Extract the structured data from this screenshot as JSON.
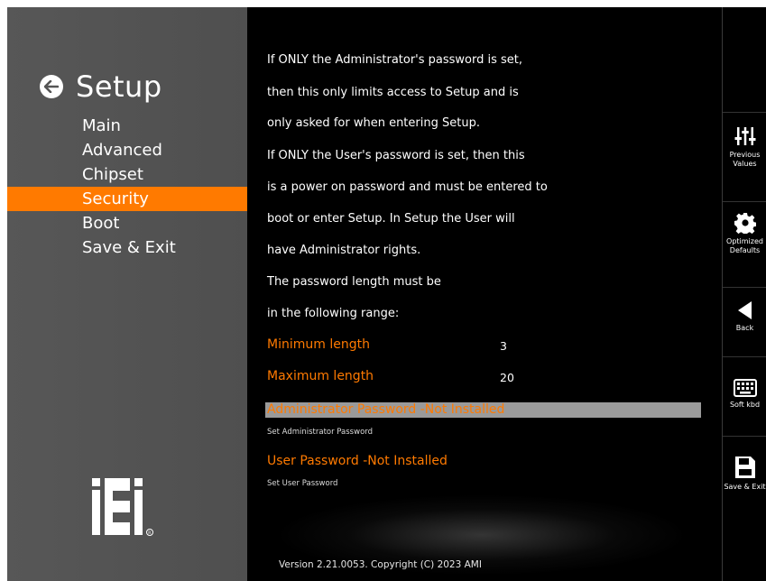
{
  "header": {
    "title": "Setup"
  },
  "sidebar": {
    "items": [
      {
        "label": "Main"
      },
      {
        "label": "Advanced"
      },
      {
        "label": "Chipset"
      },
      {
        "label": "Security"
      },
      {
        "label": "Boot"
      },
      {
        "label": "Save & Exit"
      }
    ],
    "active_index": 3,
    "logo_text": "iEi"
  },
  "help_lines": [
    "If ONLY the Administrator's password is set,",
    "then this only limits access to Setup and is",
    "only asked for when entering Setup.",
    "If ONLY the User's password is set, then this",
    "is a power on password and must be entered to",
    "boot or enter Setup. In Setup the User will",
    "have Administrator rights.",
    "The password length must be",
    "in the following range:"
  ],
  "settings": {
    "min_label": "Minimum length",
    "min_value": "3",
    "max_label": "Maximum length",
    "max_value": "20",
    "admin_label": "Administrator Password -Not Installed",
    "admin_desc": "Set Administrator Password",
    "user_label": "User Password -Not Installed",
    "user_desc": "Set User Password"
  },
  "footer": {
    "version": "Version 2.21.0053. Copyright (C) 2023 AMI"
  },
  "toolbar": {
    "previous_line1": "Previous",
    "previous_line2": "Values",
    "optimized_line1": "Optimized",
    "optimized_line2": "Defaults",
    "back": "Back",
    "soft_kbd": "Soft kbd",
    "save_exit": "Save & Exit"
  },
  "colors": {
    "accent": "#ff7a00",
    "sidebar": "#555555",
    "highlight": "#9a9a9a"
  }
}
